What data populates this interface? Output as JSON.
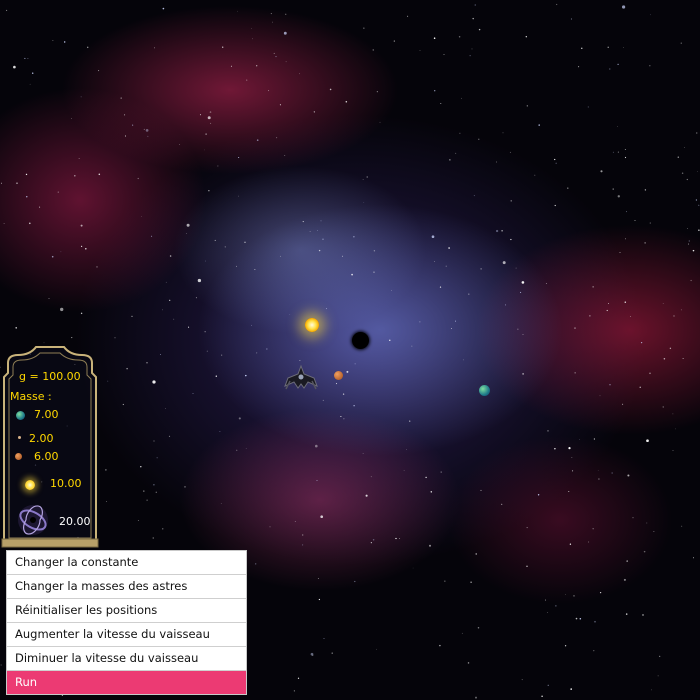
{
  "simulation": {
    "g_label": "g = 100.00",
    "masse_label": "Masse :",
    "masses": [
      {
        "icon": "earth-planet-icon",
        "value": "7.00"
      },
      {
        "icon": "small-dot-icon",
        "value": "2.00"
      },
      {
        "icon": "orange-planet-icon",
        "value": "6.00"
      },
      {
        "icon": "sun-icon",
        "value": "10.00"
      },
      {
        "icon": "black-hole-galaxy-icon",
        "value": "20.00"
      }
    ]
  },
  "menu": {
    "items": [
      {
        "label": "Changer la constante"
      },
      {
        "label": "Changer la masses des astres"
      },
      {
        "label": "Réinitialiser les positions"
      },
      {
        "label": "Augmenter la vitesse du vaisseau"
      },
      {
        "label": "Diminuer la vitesse du vaisseau"
      },
      {
        "label": "Run"
      }
    ],
    "active_index": 5,
    "active_color": "#ec3a73"
  },
  "colors": {
    "panel_text": "#ffd800",
    "sun": "#ffe24a",
    "earth": "#1e7a8a",
    "small_planet": "#c0622a"
  }
}
